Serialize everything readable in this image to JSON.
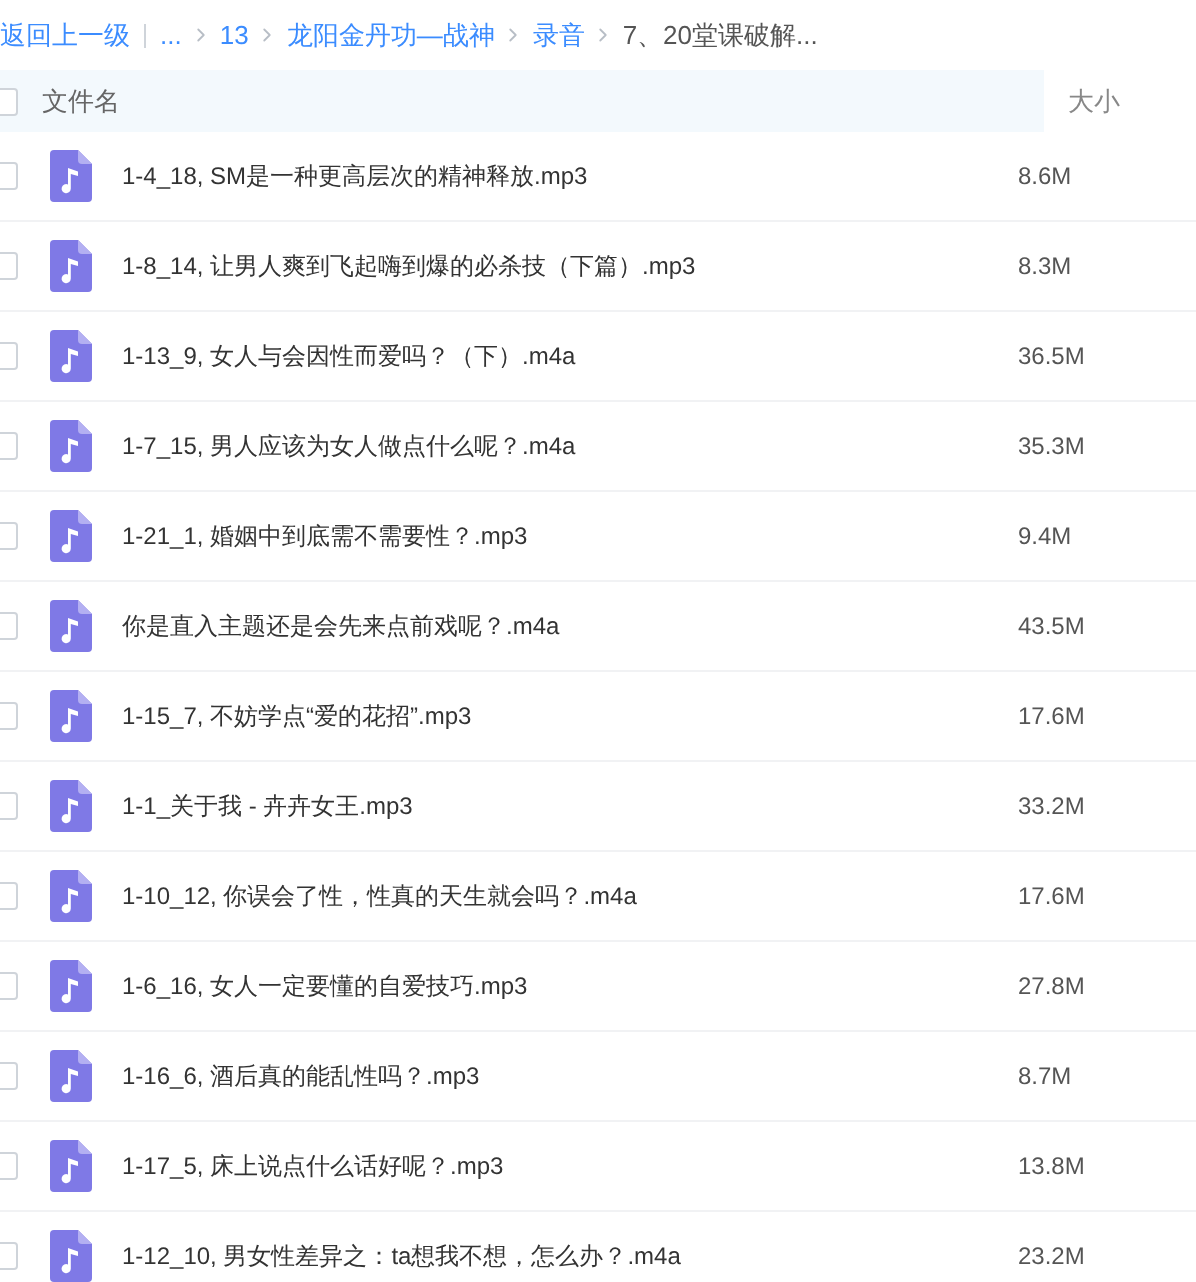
{
  "breadcrumb": {
    "back": "返回上一级",
    "items": [
      {
        "label": "...",
        "current": false
      },
      {
        "label": "13",
        "current": false
      },
      {
        "label": "龙阳金丹功—战神",
        "current": false
      },
      {
        "label": "录音",
        "current": false
      },
      {
        "label": "7、20堂课破解...",
        "current": true
      }
    ]
  },
  "table": {
    "columns": [
      "文件名",
      "大小"
    ],
    "all_checked": false,
    "rows": [
      {
        "name": "1-4_18, SM是一种更高层次的精神释放.mp3",
        "size": "8.6M",
        "checked": false
      },
      {
        "name": "1-8_14, 让男人爽到飞起嗨到爆的必杀技（下篇）.mp3",
        "size": "8.3M",
        "checked": false
      },
      {
        "name": "1-13_9, 女人与会因性而爱吗？（下）.m4a",
        "size": "36.5M",
        "checked": false
      },
      {
        "name": "1-7_15, 男人应该为女人做点什么呢？.m4a",
        "size": "35.3M",
        "checked": false
      },
      {
        "name": "1-21_1, 婚姻中到底需不需要性？.mp3",
        "size": "9.4M",
        "checked": false
      },
      {
        "name": "你是直入主题还是会先来点前戏呢？.m4a",
        "size": "43.5M",
        "checked": false
      },
      {
        "name": "1-15_7, 不妨学点“爱的花招”.mp3",
        "size": "17.6M",
        "checked": false
      },
      {
        "name": "1-1_关于我 - 卉卉女王.mp3",
        "size": "33.2M",
        "checked": false
      },
      {
        "name": "1-10_12, 你误会了性，性真的天生就会吗？.m4a",
        "size": "17.6M",
        "checked": false
      },
      {
        "name": "1-6_16, 女人一定要懂的自爱技巧.mp3",
        "size": "27.8M",
        "checked": false
      },
      {
        "name": "1-16_6, 酒后真的能乱性吗？.mp3",
        "size": "8.7M",
        "checked": false
      },
      {
        "name": "1-17_5, 床上说点什么话好呢？.mp3",
        "size": "13.8M",
        "checked": false
      },
      {
        "name": "1-12_10, 男女性差异之：ta想我不想，怎么办？.m4a",
        "size": "23.2M",
        "checked": false
      }
    ]
  }
}
